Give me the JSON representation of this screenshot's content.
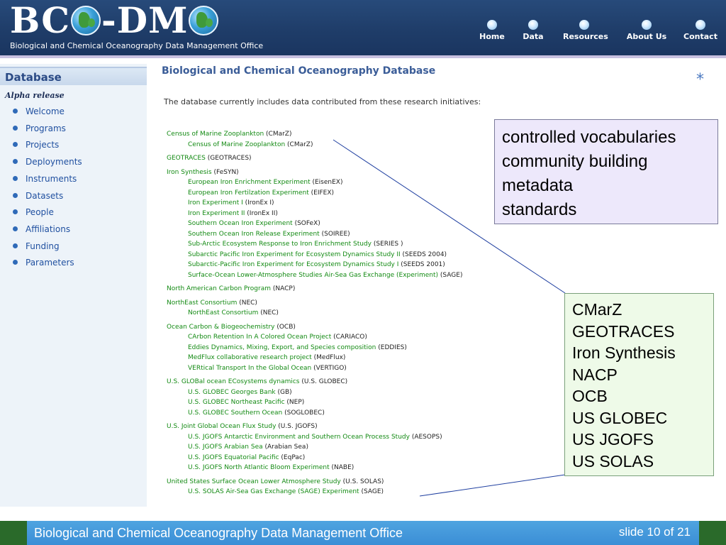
{
  "header": {
    "logo_text": [
      "BC",
      "-DM"
    ],
    "subtitle": "Biological and Chemical Oceanography Data Management Office",
    "nav": [
      "Home",
      "Data",
      "Resources",
      "About Us",
      "Contact"
    ]
  },
  "sidebar": {
    "title": "Database",
    "release": "Alpha release",
    "items": [
      "Welcome",
      "Programs",
      "Projects",
      "Deployments",
      "Instruments",
      "Datasets",
      "People",
      "Affiliations",
      "Funding",
      "Parameters"
    ]
  },
  "main": {
    "title": "Biological and Chemical Oceanography Database",
    "asterisk": "*",
    "intro": "The database currently includes data contributed from these research initiatives:",
    "entries": [
      {
        "level": 1,
        "name": "Census of Marine Zooplankton",
        "abbr": "(CMarZ)"
      },
      {
        "level": 2,
        "name": "Census of Marine Zooplankton",
        "abbr": "(CMarZ)"
      },
      {
        "level": 1,
        "name": "GEOTRACES",
        "abbr": "(GEOTRACES)"
      },
      {
        "level": 1,
        "name": "Iron Synthesis",
        "abbr": "(FeSYN)"
      },
      {
        "level": 2,
        "name": "European Iron Enrichment Experiment",
        "abbr": "(EisenEX)"
      },
      {
        "level": 2,
        "name": "European Iron Fertilzation Experiment",
        "abbr": "(EIFEX)"
      },
      {
        "level": 2,
        "name": "Iron Experiment I",
        "abbr": "(IronEx I)"
      },
      {
        "level": 2,
        "name": "Iron Experiment II",
        "abbr": "(IronEx II)"
      },
      {
        "level": 2,
        "name": "Southern Ocean Iron Experiment",
        "abbr": "(SOFeX)"
      },
      {
        "level": 2,
        "name": "Southern Ocean Iron Release Experiment",
        "abbr": "(SOIREE)"
      },
      {
        "level": 2,
        "name": "Sub-Arctic Ecosystem Response to Iron Enrichment Study",
        "abbr": "(SERIES )"
      },
      {
        "level": 2,
        "name": "Subarctic Pacific Iron Experiment for Ecosystem Dynamics Study II",
        "abbr": "(SEEDS 2004)"
      },
      {
        "level": 2,
        "name": "Subarctic-Pacific Iron Experiment for Ecosystem Dynamics Study I",
        "abbr": "(SEEDS 2001)"
      },
      {
        "level": 2,
        "name": "Surface-Ocean Lower-Atmosphere Studies Air-Sea Gas Exchange (Experiment)",
        "abbr": "(SAGE)"
      },
      {
        "level": 1,
        "name": "North American Carbon Program",
        "abbr": "(NACP)"
      },
      {
        "level": 1,
        "name": "NorthEast Consortium",
        "abbr": "(NEC)"
      },
      {
        "level": 2,
        "name": "NorthEast Consortium",
        "abbr": "(NEC)"
      },
      {
        "level": 1,
        "name": "Ocean Carbon & Biogeochemistry",
        "abbr": "(OCB)"
      },
      {
        "level": 2,
        "name": "CArbon Retention In A Colored Ocean Project",
        "abbr": "(CARIACO)"
      },
      {
        "level": 2,
        "name": "Eddies Dynamics, Mixing, Export, and Species composition",
        "abbr": "(EDDIES)"
      },
      {
        "level": 2,
        "name": "MedFlux collaborative research project",
        "abbr": "(MedFlux)"
      },
      {
        "level": 2,
        "name": "VERtical Transport In the Global Ocean",
        "abbr": "(VERTIGO)"
      },
      {
        "level": 1,
        "name": "U.S. GLOBal ocean ECosystems dynamics",
        "abbr": "(U.S. GLOBEC)"
      },
      {
        "level": 2,
        "name": "U.S. GLOBEC Georges Bank",
        "abbr": "(GB)"
      },
      {
        "level": 2,
        "name": "U.S. GLOBEC Northeast Pacific",
        "abbr": "(NEP)"
      },
      {
        "level": 2,
        "name": "U.S. GLOBEC Southern Ocean",
        "abbr": "(SOGLOBEC)"
      },
      {
        "level": 1,
        "name": "U.S. Joint Global Ocean Flux Study",
        "abbr": "(U.S. JGOFS)"
      },
      {
        "level": 2,
        "name": "U.S. JGOFS Antarctic Environment and Southern Ocean Process Study",
        "abbr": "(AESOPS)"
      },
      {
        "level": 2,
        "name": "U.S. JGOFS Arabian Sea",
        "abbr": "(Arabian Sea)"
      },
      {
        "level": 2,
        "name": "U.S. JGOFS Equatorial Pacific",
        "abbr": "(EqPac)"
      },
      {
        "level": 2,
        "name": "U.S. JGOFS North Atlantic Bloom Experiment",
        "abbr": "(NABE)"
      },
      {
        "level": 1,
        "name": "United States Surface Ocean Lower Atmosphere Study",
        "abbr": "(U.S. SOLAS)"
      },
      {
        "level": 2,
        "name": "U.S. SOLAS Air-Sea Gas Exchange (SAGE) Experiment",
        "abbr": "(SAGE)"
      }
    ]
  },
  "callouts": {
    "top": [
      "controlled vocabularies",
      "community building",
      "metadata",
      "standards"
    ],
    "list": [
      "CMarZ",
      "GEOTRACES",
      "Iron Synthesis",
      "NACP",
      "OCB",
      "US GLOBEC",
      "US JGOFS",
      "US SOLAS"
    ]
  },
  "footer": {
    "text": "Biological and Chemical Oceanography Data Management Office",
    "slide": "slide 10 of 21"
  },
  "colors": {
    "header": "#1f3d69",
    "link_green": "#138a13",
    "sidebar_link": "#2050a0",
    "footer_bar": "#3b8ed6",
    "footer_bg": "#2a6a2a"
  }
}
